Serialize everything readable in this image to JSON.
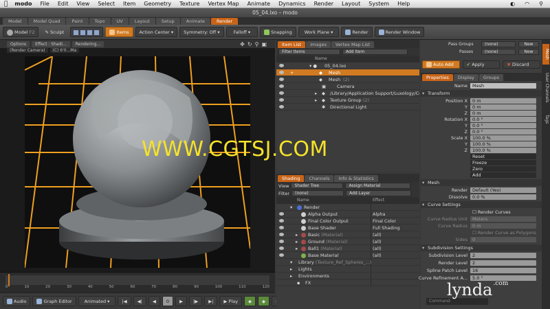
{
  "menubar": {
    "app": "modo",
    "items": [
      "File",
      "Edit",
      "View",
      "Select",
      "Item",
      "Geometry",
      "Texture",
      "Vertex Map",
      "Animate",
      "Dynamics",
      "Render",
      "Layout",
      "System",
      "Help"
    ]
  },
  "window": {
    "title": "05_04.lxo – modo"
  },
  "layout_tabs": [
    "Model",
    "Model Quad",
    "Paint",
    "Topo",
    "UV",
    "Layout",
    "Setup",
    "Animate",
    "Render"
  ],
  "toolbar": {
    "model": "Model",
    "model_key": "F2",
    "sculpt": "Sculpt",
    "items": "Items",
    "action_center": "Action Center",
    "symmetry": "Symmetry: Off",
    "falloff": "Falloff",
    "snapping": "Snapping",
    "work_plane": "Work Plane",
    "render": "Render",
    "render_window": "Render Window"
  },
  "viewport": {
    "buttons": [
      "Options",
      "Effect : Shadi...",
      "Rendering..."
    ],
    "sub": [
      "(Render Camera)",
      "(C) 6'0...Ma"
    ]
  },
  "timeline": {
    "ticks": [
      "0",
      "10",
      "20",
      "30",
      "40",
      "50",
      "60",
      "70",
      "80",
      "90",
      "100",
      "110",
      "120"
    ]
  },
  "bottombar": {
    "audio": "Audio",
    "graph_editor": "Graph Editor",
    "animated": "Animated",
    "frame": "0",
    "play": "Play"
  },
  "item_list": {
    "tabs": [
      "Item List",
      "Images",
      "Vertex Map List"
    ],
    "filter": "Filter Items",
    "add_item": "Add Item",
    "header": "Name",
    "rows": [
      {
        "label": "05_04.lxo",
        "extra": ""
      },
      {
        "label": "Mesh",
        "extra": ""
      },
      {
        "label": "Mesh",
        "extra": "(2)"
      },
      {
        "label": "Camera",
        "extra": ""
      },
      {
        "label": "/Library/Application Support/Luxology/Co",
        "extra": ""
      },
      {
        "label": "Texture Group",
        "extra": "(2)"
      },
      {
        "label": "Directional Light",
        "extra": ""
      }
    ]
  },
  "shading": {
    "tabs": [
      "Shading",
      "Channels",
      "Info & Statistics"
    ],
    "view_label": "View",
    "view_value": "Shader Tree",
    "assign_material": "Assign Material",
    "filter_label": "Filter",
    "filter_value": "(none)",
    "add_layer": "Add Layer",
    "col_name": "Name",
    "col_effect": "Effect",
    "rows": [
      {
        "name": "Render",
        "sub": "",
        "effect": ""
      },
      {
        "name": "Alpha Output",
        "sub": "",
        "effect": "Alpha"
      },
      {
        "name": "Final Color Output",
        "sub": "",
        "effect": "Final Color"
      },
      {
        "name": "Base Shader",
        "sub": "",
        "effect": "Full Shading"
      },
      {
        "name": "Basic",
        "sub": "(Material)",
        "effect": "(all)"
      },
      {
        "name": "Ground",
        "sub": "(Material)",
        "effect": "(all)"
      },
      {
        "name": "Ball1",
        "sub": "(Material)",
        "effect": "(all)"
      },
      {
        "name": "Base Material",
        "sub": "",
        "effect": "(all)"
      },
      {
        "name": "Library",
        "sub": "(Texture_Ref_Spheres_...)",
        "effect": ""
      },
      {
        "name": "Lights",
        "sub": "",
        "effect": ""
      },
      {
        "name": "Environments",
        "sub": "",
        "effect": ""
      },
      {
        "name": "FX",
        "sub": "",
        "effect": ""
      }
    ],
    "colors": [
      "#4a6fd0",
      "#cfcfcf",
      "#cfcfcf",
      "#cfcfcf",
      "#a54a4a",
      "#a54a4a",
      "#a54a4a",
      "#7fb04a"
    ]
  },
  "properties": {
    "pass_groups_label": "Pass Groups",
    "pass_groups_value": "(none)",
    "passes_label": "Passes",
    "passes_value": "(none)",
    "new": "New",
    "auto_add": "Auto Add",
    "apply": "Apply",
    "discard": "Discard",
    "tabs": [
      "Properties",
      "Display",
      "Groups"
    ],
    "side_tabs": [
      "Mesh",
      "User Channels",
      "Tags"
    ],
    "name_label": "Name",
    "name_value": "Mesh",
    "transform": "Transform",
    "position": "Position X",
    "rotation": "Rotation X",
    "scale": "Scale X",
    "axis_y": "Y",
    "axis_z": "Z",
    "pos": [
      "0 m",
      "0 m",
      "0 m"
    ],
    "rot": [
      "0.0 °",
      "0.0 °",
      "0.0 °"
    ],
    "scl": [
      "100.0 %",
      "100.0 %",
      "100.0 %"
    ],
    "actions": [
      "Reset",
      "Freeze",
      "Zero",
      "Add"
    ],
    "mesh": "Mesh",
    "render_label": "Render",
    "render_value": "Default (Yes)",
    "dissolve_label": "Dissolve",
    "dissolve_value": "0.0 %",
    "curve_settings": "Curve Settings",
    "render_curves": "Render Curves",
    "curve_radius_unit": "Curve Radius Unit",
    "curve_radius_unit_value": "Meters",
    "curve_radius": "Curve Radius",
    "curve_radius_value": "0 m",
    "render_curve_polygons": "Render Curve as Polygons",
    "sides": "Sides",
    "sides_value": "0",
    "subdivision_settings": "Subdivision Settings",
    "subdivision_level": "Subdivision Level",
    "subdivision_level_value": "2",
    "render_level": "Render Level",
    "render_level_value": "2",
    "spline_patch_level": "Spline Patch Level",
    "spline_patch_level_value": "16",
    "curve_refinement": "Curve Refinement A...",
    "curve_refinement_value": "5.0 °",
    "command": "Command"
  },
  "watermark": "WWW.CGTSJ.COM",
  "brand": "lynda",
  "brand_suffix": ".com",
  "colors": {
    "accent": "#d07a22",
    "grid": "#f0a020",
    "watermark": "#f5e22a"
  }
}
